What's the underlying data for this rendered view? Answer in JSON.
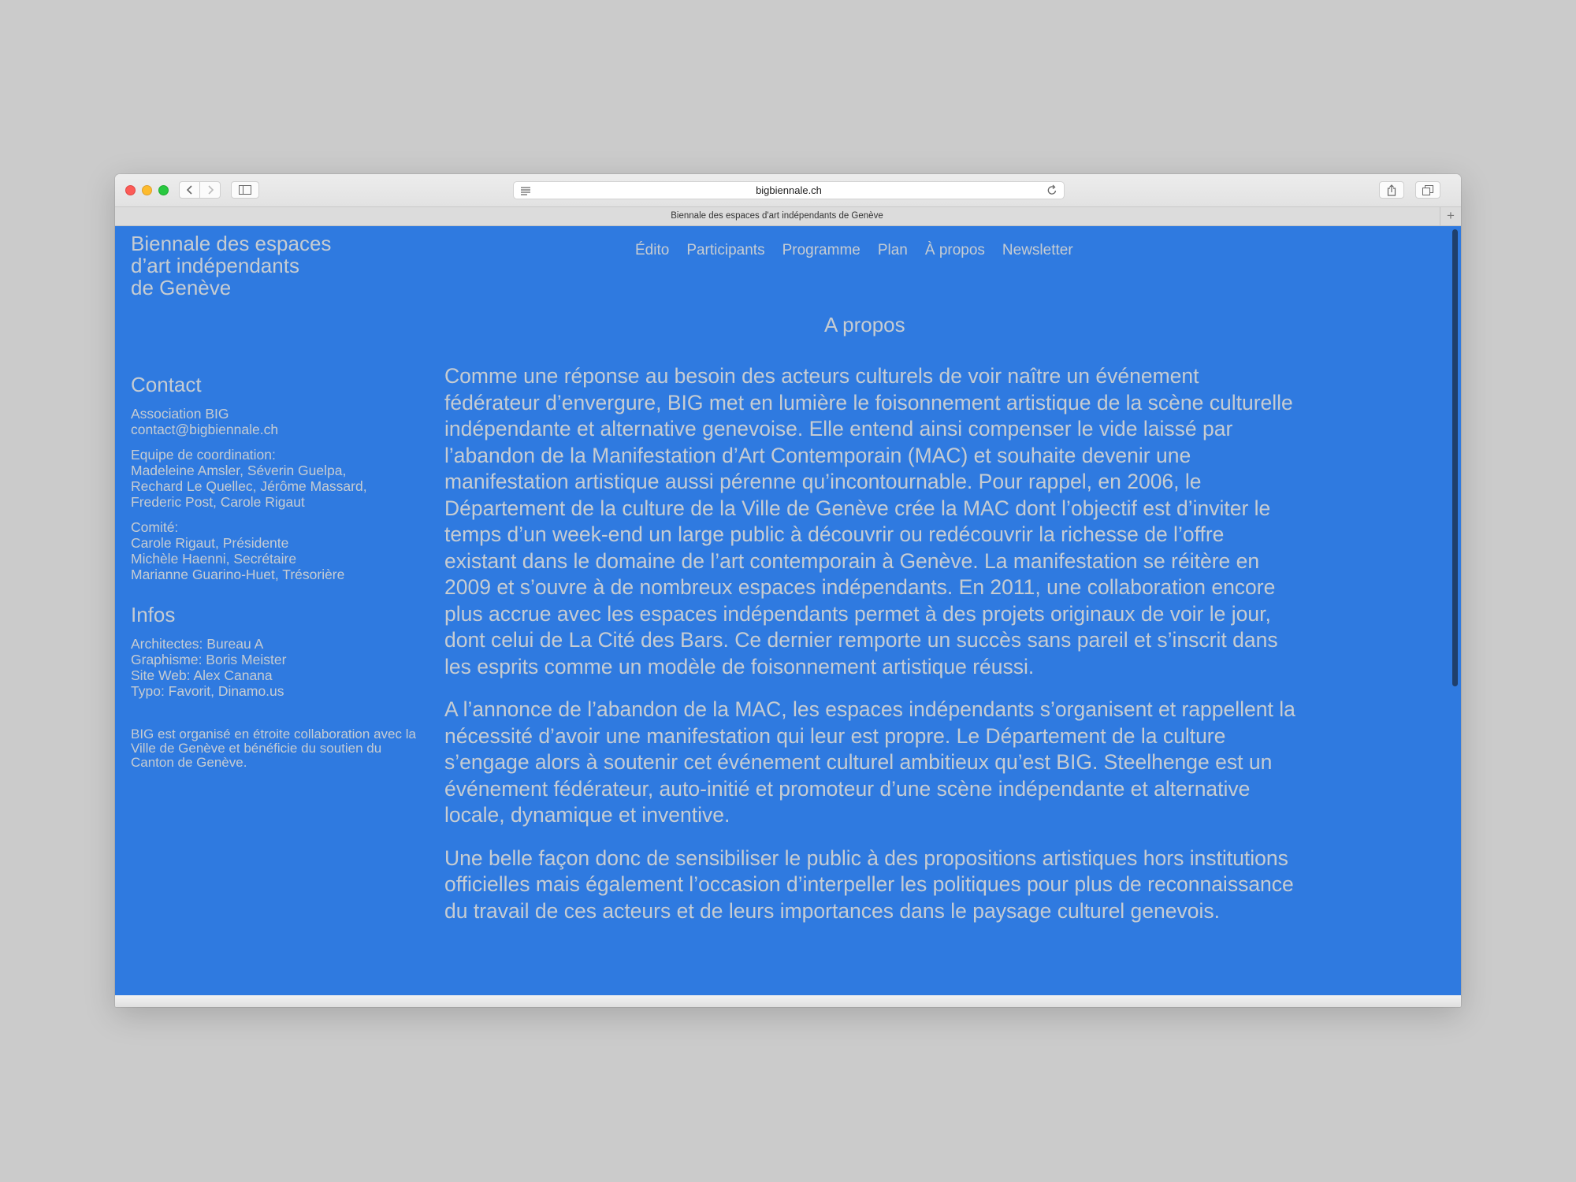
{
  "browser": {
    "url": "bigbiennale.ch",
    "tab_title": "Biennale des espaces d'art indépendants de Genève",
    "new_tab_label": "+"
  },
  "site": {
    "title": "Biennale des espaces\nd’art indépendants\nde Genève"
  },
  "nav": {
    "items": [
      "Édito",
      "Participants",
      "Programme",
      "Plan",
      "À propos",
      "Newsletter"
    ]
  },
  "page": {
    "heading": "A propos",
    "paragraphs": [
      "Comme une réponse au besoin des acteurs culturels de voir naître un événement fédérateur d’envergure, BIG met en lumière le foisonnement artistique de la scène culturelle indépendante et alternative genevoise. Elle entend ainsi compenser le vide laissé par l’abandon de la Manifestation d’Art Contemporain (MAC) et souhaite devenir une manifestation artistique aussi pérenne qu’incontournable. Pour rappel, en 2006, le Département de la culture de la Ville de Genève crée la MAC dont l’objectif est d’inviter le temps d’un week-end un large public à découvrir ou redécouvrir la richesse de l’offre existant dans le domaine de l’art contemporain à Genève. La manifestation se réitère en 2009 et s’ouvre à de nombreux espaces indépendants. En 2011, une collaboration encore plus accrue avec les espaces indépendants permet à des projets originaux de voir le jour, dont celui de La Cité des Bars. Ce dernier remporte un succès sans pareil et s’inscrit dans les esprits comme un modèle de foisonnement artistique réussi.",
      "A l’annonce de l’abandon de la MAC, les espaces indépendants s’organisent et rappellent la nécessité d’avoir une manifestation qui leur est propre. Le Département de la culture s’engage alors à soutenir cet événement culturel ambitieux qu’est BIG. Steelhenge est un événement fédérateur, auto-initié et promoteur d’une scène indépendante et alternative locale, dynamique et inventive.",
      "Une belle façon donc de sensibiliser le public à des propositions artistiques hors institutions officielles mais également l’occasion d’interpeller les politiques pour plus de reconnaissance du travail de ces acteurs et de leurs importances dans le paysage culturel genevois."
    ]
  },
  "sidebar": {
    "contact_heading": "Contact",
    "association": "Association BIG\ncontact@bigbiennale.ch",
    "coordination": "Equipe de coordination:\nMadeleine Amsler, Séverin Guelpa,\nRechard Le Quellec, Jérôme Massard,\nFrederic Post, Carole Rigaut",
    "comite": "Comité:\nCarole Rigaut, Présidente\nMichèle Haenni, Secrétaire\nMarianne Guarino-Huet, Trésorière",
    "infos_heading": "Infos",
    "credits": "Architectes: Bureau A\nGraphisme: Boris Meister\nSite Web: Alex Canana\nTypo: Favorit, Dinamo.us",
    "note": "BIG est organisé en étroite collaboration avec la Ville de Genève et bénéficie du soutien du Canton de Genève."
  },
  "colors": {
    "page_background": "#2f7ae0",
    "text": "#c6ccd2",
    "desktop_background": "#cbcbcb"
  }
}
